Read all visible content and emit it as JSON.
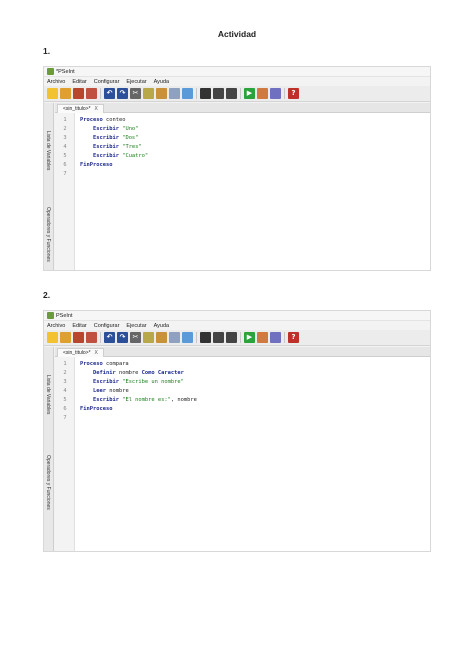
{
  "document": {
    "title": "Actividad",
    "section1_number": "1.",
    "section2_number": "2."
  },
  "app1": {
    "window_title": "*PSeInt",
    "menu": [
      "Archivo",
      "Editar",
      "Configurar",
      "Ejecutar",
      "Ayuda"
    ],
    "file_tab": "<sin_titulo>*",
    "tab_close": "X",
    "side_tabs": [
      "Lista de Variables",
      "Operadores y Funciones"
    ],
    "lines": [
      {
        "n": "1",
        "parts": [
          {
            "t": "Proceso",
            "c": "kw"
          },
          {
            "t": " conteo",
            "c": "id"
          }
        ]
      },
      {
        "n": "2",
        "parts": [
          {
            "t": "    Escribir",
            "c": "kw"
          },
          {
            "t": " \"Uno\"",
            "c": "str"
          }
        ]
      },
      {
        "n": "3",
        "parts": [
          {
            "t": "    Escribir",
            "c": "kw"
          },
          {
            "t": " \"Dos\"",
            "c": "str"
          }
        ]
      },
      {
        "n": "4",
        "parts": [
          {
            "t": "    Escribir",
            "c": "kw"
          },
          {
            "t": " \"Tres\"",
            "c": "str"
          }
        ]
      },
      {
        "n": "5",
        "parts": [
          {
            "t": "    Escribir",
            "c": "kw"
          },
          {
            "t": " \"Cuatro\"",
            "c": "str"
          }
        ]
      },
      {
        "n": "6",
        "parts": [
          {
            "t": "FinProceso",
            "c": "kw"
          }
        ]
      },
      {
        "n": "7",
        "parts": []
      }
    ]
  },
  "app2": {
    "window_title": "PSeInt",
    "menu": [
      "Archivo",
      "Editar",
      "Configurar",
      "Ejecutar",
      "Ayuda"
    ],
    "file_tab": "<sin_titulo>*",
    "tab_close": "X",
    "side_tabs": [
      "Lista de Variables",
      "Operadores y Funciones"
    ],
    "lines": [
      {
        "n": "1",
        "parts": [
          {
            "t": "Proceso",
            "c": "kw"
          },
          {
            "t": " compara",
            "c": "id"
          }
        ]
      },
      {
        "n": "2",
        "parts": [
          {
            "t": "    Definir",
            "c": "kw"
          },
          {
            "t": " nombre ",
            "c": "id"
          },
          {
            "t": "Como Caracter",
            "c": "kw"
          }
        ]
      },
      {
        "n": "3",
        "parts": [
          {
            "t": "    Escribir",
            "c": "kw"
          },
          {
            "t": " \"Escribe un nombre\"",
            "c": "str"
          }
        ]
      },
      {
        "n": "4",
        "parts": [
          {
            "t": "    Leer",
            "c": "kw"
          },
          {
            "t": " nombre",
            "c": "id"
          }
        ]
      },
      {
        "n": "5",
        "parts": [
          {
            "t": "    Escribir",
            "c": "kw"
          },
          {
            "t": " \"El nombre es:\"",
            "c": "str"
          },
          {
            "t": ", nombre",
            "c": "id"
          }
        ]
      },
      {
        "n": "6",
        "parts": [
          {
            "t": "FinProceso",
            "c": "kw"
          }
        ]
      },
      {
        "n": "7",
        "parts": []
      }
    ]
  },
  "toolbar_icons": [
    {
      "name": "new-file-icon",
      "color": "#f2c230",
      "glyph": ""
    },
    {
      "name": "open-folder-icon",
      "color": "#e0a030",
      "glyph": ""
    },
    {
      "name": "save-icon",
      "color": "#b8462f",
      "glyph": ""
    },
    {
      "name": "save-as-icon",
      "color": "#c05040",
      "glyph": ""
    },
    {
      "sep": true
    },
    {
      "name": "undo-icon",
      "color": "#2c4f9a",
      "glyph": "↶"
    },
    {
      "name": "redo-icon",
      "color": "#2c4f9a",
      "glyph": "↷"
    },
    {
      "name": "cut-icon",
      "color": "#666666",
      "glyph": "✂"
    },
    {
      "name": "copy-icon",
      "color": "#b9a84a",
      "glyph": ""
    },
    {
      "name": "paste-icon",
      "color": "#c9913a",
      "glyph": ""
    },
    {
      "name": "indent-icon",
      "color": "#8fa0c0",
      "glyph": ""
    },
    {
      "name": "comment-icon",
      "color": "#5a9ad8",
      "glyph": ""
    },
    {
      "sep": true
    },
    {
      "name": "search-icon",
      "color": "#333333",
      "glyph": ""
    },
    {
      "name": "search-next-icon",
      "color": "#444444",
      "glyph": ""
    },
    {
      "name": "replace-icon",
      "color": "#444444",
      "glyph": ""
    },
    {
      "sep": true
    },
    {
      "name": "run-icon",
      "color": "#2aa33a",
      "glyph": "▶"
    },
    {
      "name": "step-icon",
      "color": "#d07a40",
      "glyph": ""
    },
    {
      "name": "flowchart-icon",
      "color": "#7070c0",
      "glyph": ""
    },
    {
      "sep": true
    },
    {
      "name": "help-icon",
      "color": "#c0302a",
      "glyph": "?"
    }
  ]
}
